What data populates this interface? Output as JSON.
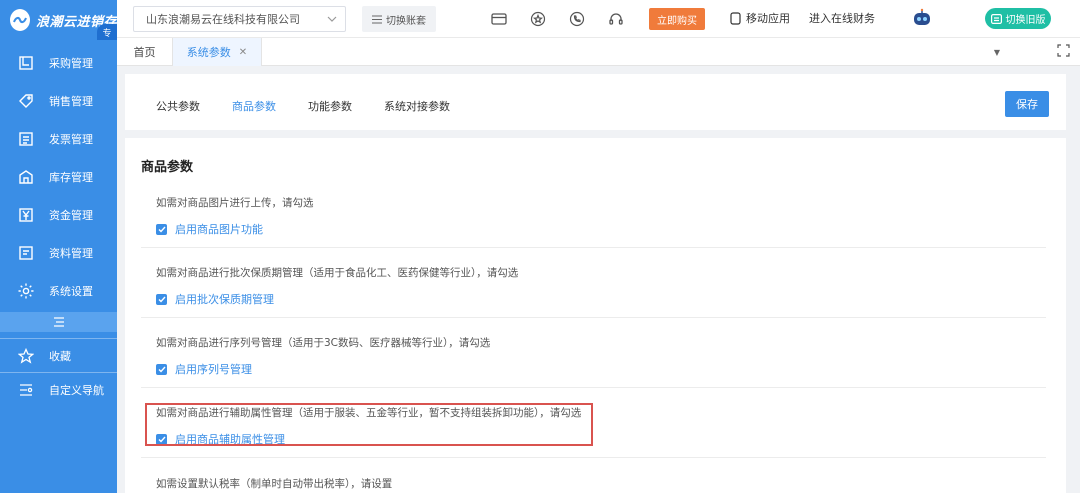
{
  "sidebar": {
    "logo_text": "浪潮云进销存",
    "logo_badge": "专",
    "items": [
      {
        "label": "采购管理",
        "icon": "purchase-icon"
      },
      {
        "label": "销售管理",
        "icon": "tag-icon"
      },
      {
        "label": "发票管理",
        "icon": "invoice-icon"
      },
      {
        "label": "库存管理",
        "icon": "warehouse-icon"
      },
      {
        "label": "资金管理",
        "icon": "yen-icon"
      },
      {
        "label": "资料管理",
        "icon": "document-icon"
      },
      {
        "label": "系统设置",
        "icon": "gear-icon"
      }
    ],
    "bottom_items": [
      {
        "label": "收藏",
        "icon": "star-icon"
      },
      {
        "label": "自定义导航",
        "icon": "custom-nav-icon"
      }
    ]
  },
  "header": {
    "company": "山东浪潮易云在线科技有限公司",
    "switch_account": "切换账套",
    "buy_now": "立即购买",
    "mobile_app": "移动应用",
    "online_finance": "进入在线财务",
    "switch_old": "切换旧版"
  },
  "tabs": {
    "home": "首页",
    "active": "系统参数"
  },
  "subtabs": [
    "公共参数",
    "商品参数",
    "功能参数",
    "系统对接参数"
  ],
  "save_label": "保存",
  "section_title": "商品参数",
  "options": [
    {
      "desc": "如需对商品图片进行上传，请勾选",
      "label": "启用商品图片功能",
      "checked": true
    },
    {
      "desc": "如需对商品进行批次保质期管理（适用于食品化工、医药保健等行业），请勾选",
      "label": "启用批次保质期管理",
      "checked": true
    },
    {
      "desc": "如需对商品进行序列号管理（适用于3C数码、医疗器械等行业），请勾选",
      "label": "启用序列号管理",
      "checked": true
    },
    {
      "desc": "如需对商品进行辅助属性管理（适用于服装、五金等行业，暂不支持组装拆卸功能），请勾选",
      "label": "启用商品辅助属性管理",
      "checked": true
    }
  ],
  "last_desc": "如需设置默认税率（制单时自动带出税率），请设置",
  "colors": {
    "primary": "#3a8ee6",
    "buy": "#f07b3b",
    "old": "#1fbfa5",
    "highlight": "#d9534f"
  }
}
